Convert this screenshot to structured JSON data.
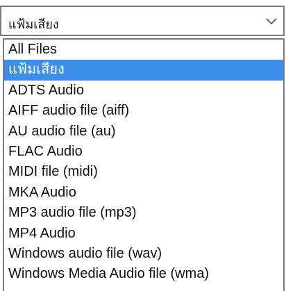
{
  "dropdown": {
    "selected_value": "แฟ้มเสียง",
    "icon": "chevron-down-icon"
  },
  "options": [
    {
      "label": "All Files",
      "selected": false
    },
    {
      "label": "แฟ้มเสียง",
      "selected": true
    },
    {
      "label": "ADTS Audio",
      "selected": false
    },
    {
      "label": "AIFF audio file (aiff)",
      "selected": false
    },
    {
      "label": "AU audio file (au)",
      "selected": false
    },
    {
      "label": "FLAC Audio",
      "selected": false
    },
    {
      "label": "MIDI file (midi)",
      "selected": false
    },
    {
      "label": "MKA Audio",
      "selected": false
    },
    {
      "label": "MP3 audio file (mp3)",
      "selected": false
    },
    {
      "label": "MP4 Audio",
      "selected": false
    },
    {
      "label": "Windows audio file (wav)",
      "selected": false
    },
    {
      "label": "Windows Media Audio file (wma)",
      "selected": false
    }
  ],
  "colors": {
    "selection": "#3d8ee8",
    "border": "#7a7a7a",
    "text": "#111111"
  }
}
